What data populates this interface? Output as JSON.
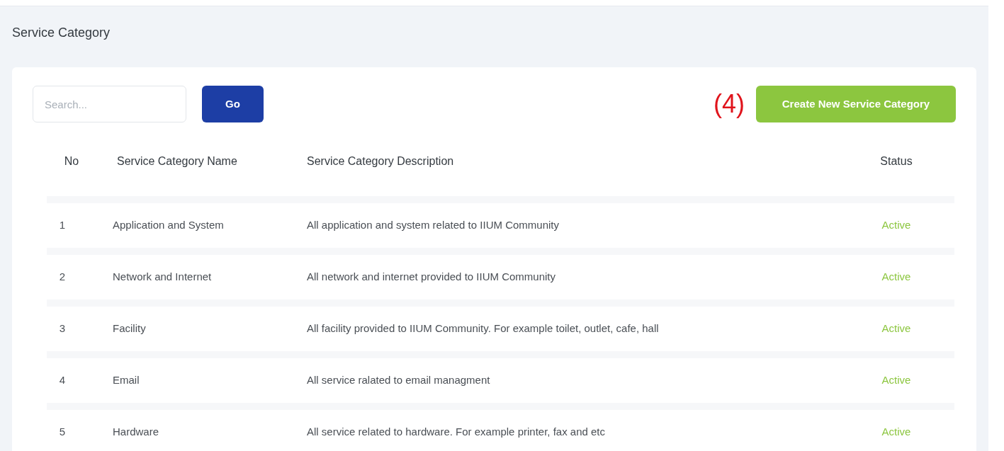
{
  "page_title": "Service Category",
  "search": {
    "placeholder": "Search...",
    "button": "Go"
  },
  "annotation": "(4)",
  "create_button": "Create New Service Category",
  "table": {
    "columns": [
      "No",
      "Service Category Name",
      "Service Category Description",
      "Status"
    ],
    "rows": [
      {
        "no": "1",
        "name": "Application and System",
        "description": "All application and system related to IIUM Community",
        "status": "Active"
      },
      {
        "no": "2",
        "name": "Network and Internet",
        "description": "All network and internet provided to IIUM Community",
        "status": "Active"
      },
      {
        "no": "3",
        "name": "Facility",
        "description": "All facility provided to IIUM Community. For example toilet, outlet, cafe, hall",
        "status": "Active"
      },
      {
        "no": "4",
        "name": "Email",
        "description": "All service ralated to email managment",
        "status": "Active"
      },
      {
        "no": "5",
        "name": "Hardware",
        "description": "All service related to hardware. For example printer, fax and etc",
        "status": "Active"
      }
    ]
  }
}
